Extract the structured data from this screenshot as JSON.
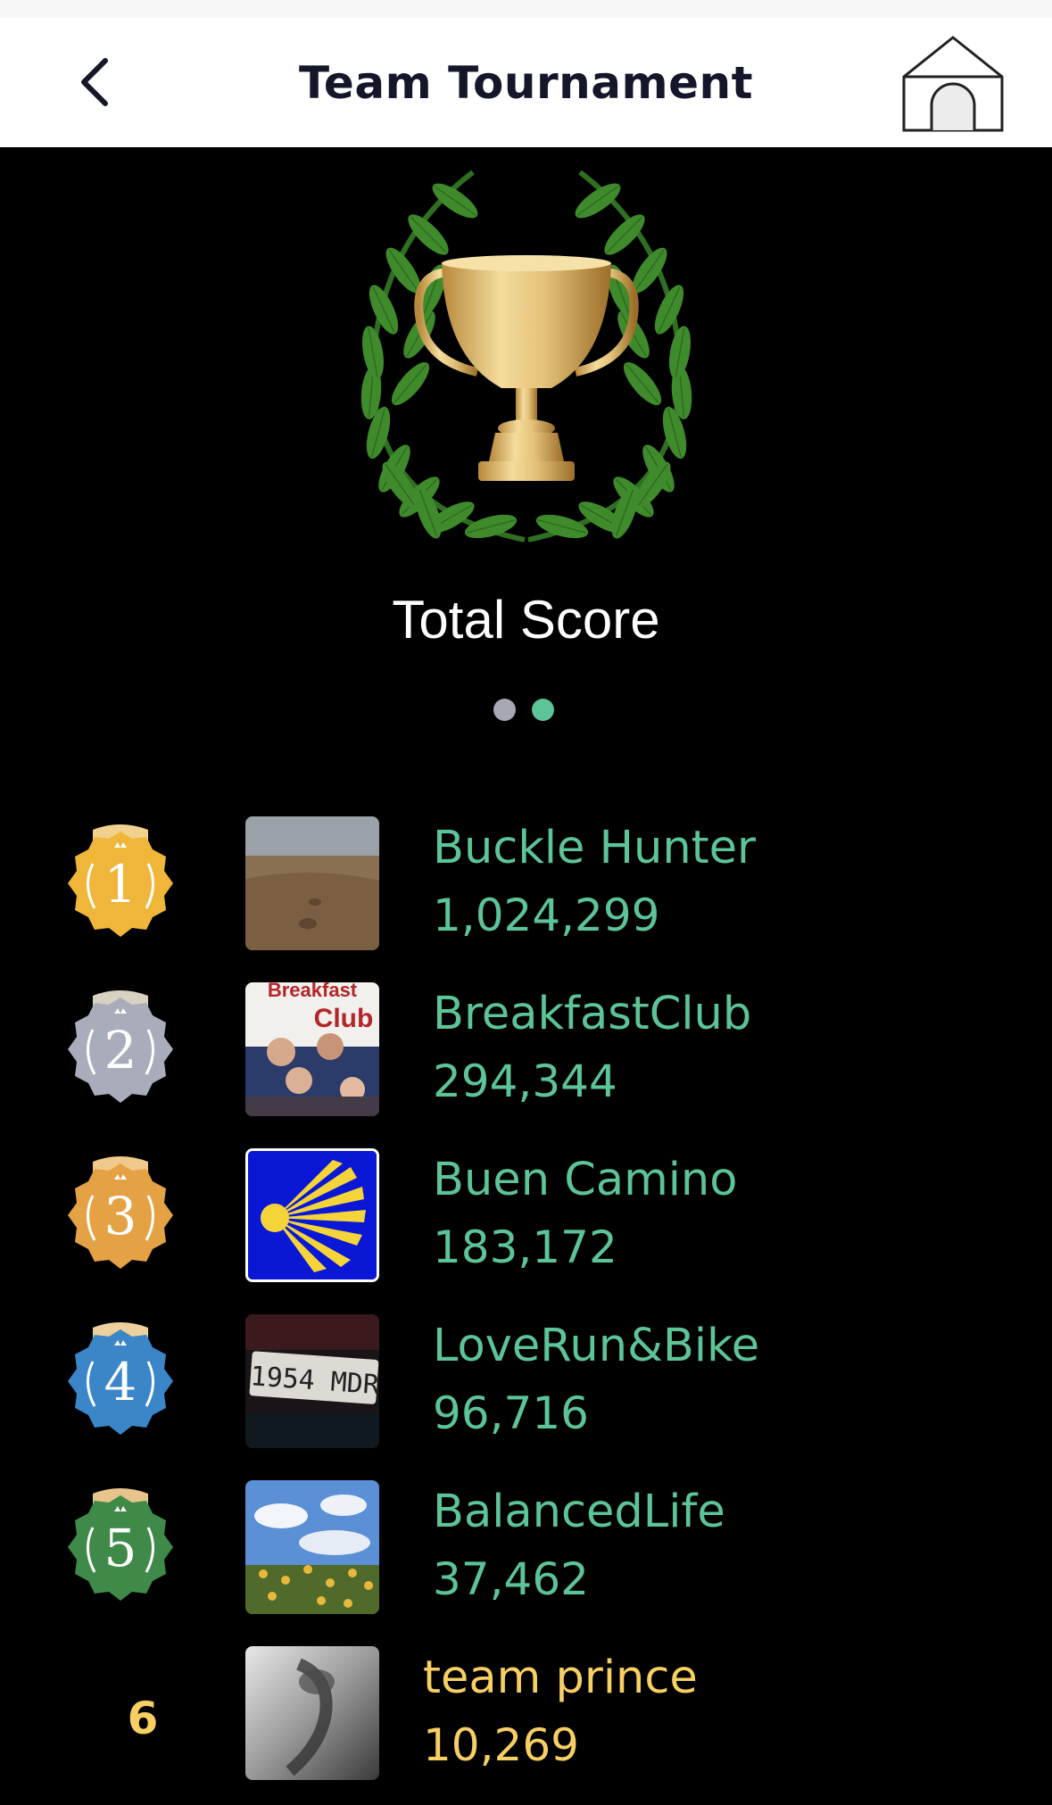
{
  "header": {
    "title": "Team Tournament",
    "back_icon": "chevron-left-icon",
    "home_icon": "house-icon"
  },
  "hero": {
    "icon": "trophy-with-laurel-icon",
    "subtitle": "Total Score"
  },
  "pager": {
    "pages": 2,
    "active_page": 2,
    "active_color": "#5cc497",
    "inactive_color": "#a7a8b4"
  },
  "colors": {
    "team_text": "#5cc497",
    "self_text": "#f7cf62"
  },
  "teams": [
    {
      "rank": "1",
      "name": "Buckle Hunter",
      "score": "1,024,299",
      "medal_color": "#f0b63a"
    },
    {
      "rank": "2",
      "name": "BreakfastClub",
      "score": "294,344",
      "medal_color": "#a9adbb"
    },
    {
      "rank": "3",
      "name": "Buen Camino",
      "score": "183,172",
      "medal_color": "#e5a244"
    },
    {
      "rank": "4",
      "name": "LoveRun&Bike",
      "score": "96,716",
      "medal_color": "#3a86c9"
    },
    {
      "rank": "5",
      "name": "BalancedLife",
      "score": "37,462",
      "medal_color": "#3f8a48"
    },
    {
      "rank": "6",
      "name": "team prince",
      "score": "10,269"
    }
  ],
  "avatar_text": {
    "breakfast_top": "Breakfast",
    "breakfast_club": "Club",
    "plate": "1954 MDR"
  }
}
